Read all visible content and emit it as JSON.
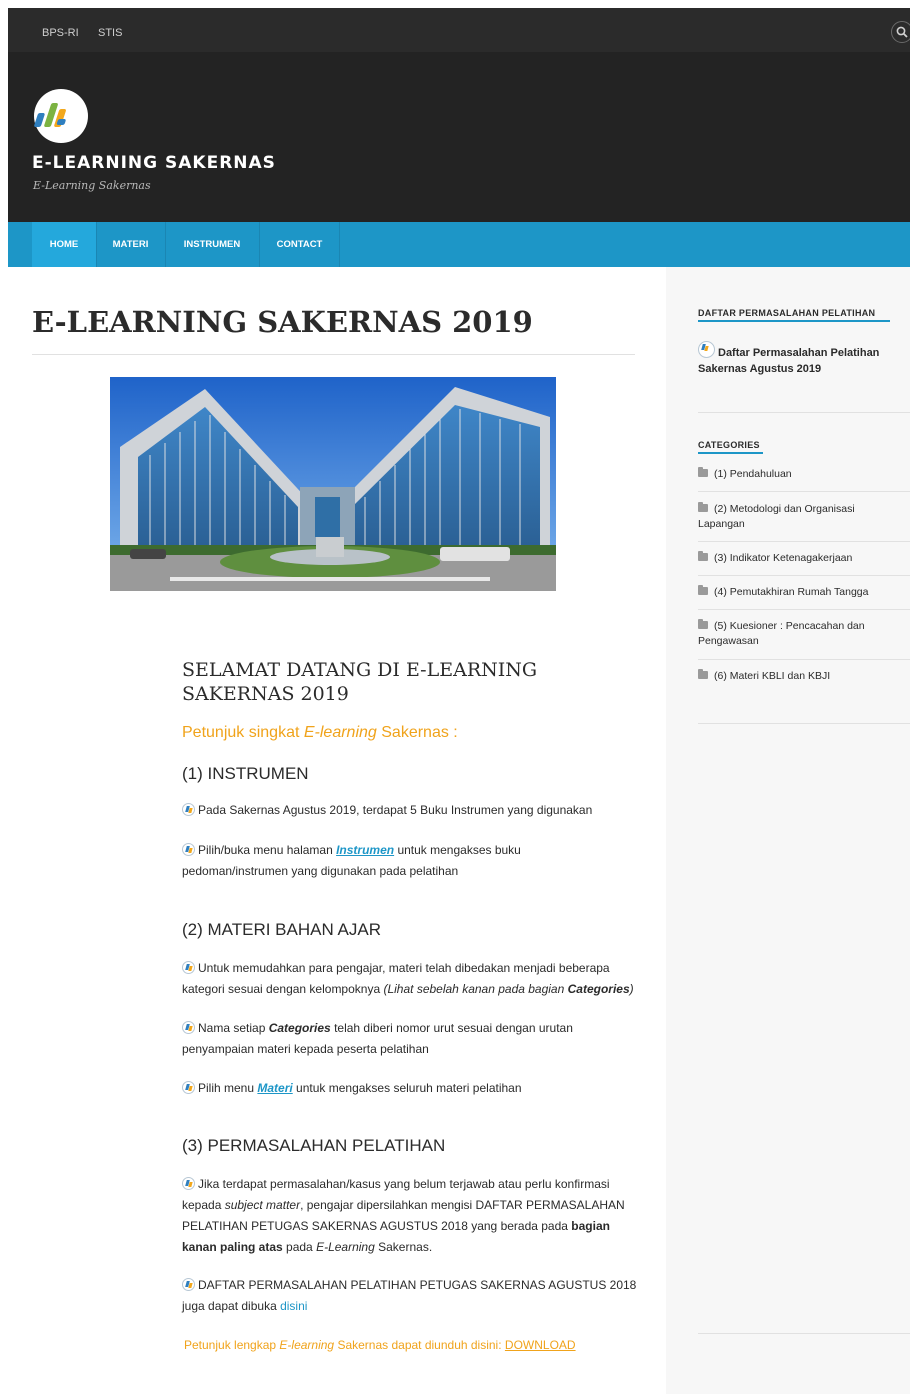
{
  "topbar": {
    "links": [
      "BPS-RI",
      "STIS"
    ],
    "search_icon": "search-icon"
  },
  "header": {
    "logo_icon": "bps-logo-icon",
    "site_title": "E-LEARNING SAKERNAS",
    "site_description": "E-Learning Sakernas"
  },
  "nav": {
    "items": [
      "HOME",
      "MATERI",
      "INSTRUMEN",
      "CONTACT"
    ],
    "active": "HOME"
  },
  "main": {
    "page_title": "E-LEARNING SAKERNAS 2019",
    "welcome": "SELAMAT DATANG DI E-LEARNING SAKERNAS 2019",
    "hint_pre": "Petunjuk singkat ",
    "hint_em": "E-learning",
    "hint_post": " Sakernas :",
    "s1": {
      "heading": "(1) INSTRUMEN",
      "p1": "Pada Sakernas Agustus 2019, terdapat 5 Buku Instrumen yang digunakan",
      "p2_pre": "Pilih/buka menu halaman ",
      "p2_link": "Instrumen",
      "p2_post": " untuk mengakses buku pedoman/instrumen yang digunakan pada pelatihan"
    },
    "s2": {
      "heading": "(2) MATERI BAHAN AJAR",
      "p1_pre": "Untuk memudahkan para pengajar, materi telah dibedakan menjadi beberapa kategori sesuai dengan kelompoknya ",
      "p1_em": "(Lihat sebelah kanan pada bagian ",
      "p1_strong": "Categories",
      "p1_end": ")",
      "p2_pre": "Nama setiap ",
      "p2_strong": "Categories",
      "p2_post": " telah diberi nomor urut sesuai dengan urutan penyampaian materi kepada peserta pelatihan",
      "p3_pre": "Pilih menu ",
      "p3_link": "Materi",
      "p3_post": " untuk mengakses seluruh materi pelatihan"
    },
    "s3": {
      "heading": "(3) PERMASALAHAN PELATIHAN",
      "p1_a": "Jika terdapat permasalahan/kasus yang belum terjawab atau perlu konfirmasi kepada ",
      "p1_em": "subject matter",
      "p1_b": ", pengajar dipersilahkan mengisi DAFTAR PERMASALAHAN PELATIHAN PETUGAS SAKERNAS AGUSTUS 2018 yang berada pada ",
      "p1_strong": "bagian kanan paling atas",
      "p1_c": " pada ",
      "p1_em2": "E-Learning",
      "p1_d": " Sakernas.",
      "p2_pre": "DAFTAR PERMASALAHAN PELATIHAN PETUGAS SAKERNAS AGUSTUS 2018 juga dapat dibuka ",
      "p2_link": "disini"
    },
    "footer_pre": "Petunjuk lengkap ",
    "footer_em": "E-learning",
    "footer_mid": " Sakernas dapat diunduh disini: ",
    "footer_link": "DOWNLOAD"
  },
  "sidebar": {
    "widget1_title": "DAFTAR PERMASALAHAN PELATIHAN",
    "widget1_link": "Daftar Permasalahan Pelatihan Sakernas Agustus 2019",
    "widget2_title": "CATEGORIES",
    "categories": [
      "(1) Pendahuluan",
      "(2) Metodologi dan Organisasi Lapangan",
      "(3) Indikator Ketenagakerjaan",
      "(4) Pemutakhiran Rumah Tangga",
      "(5) Kuesioner : Pencacahan dan Pengawasan",
      "(6) Materi KBLI dan KBJI"
    ]
  }
}
